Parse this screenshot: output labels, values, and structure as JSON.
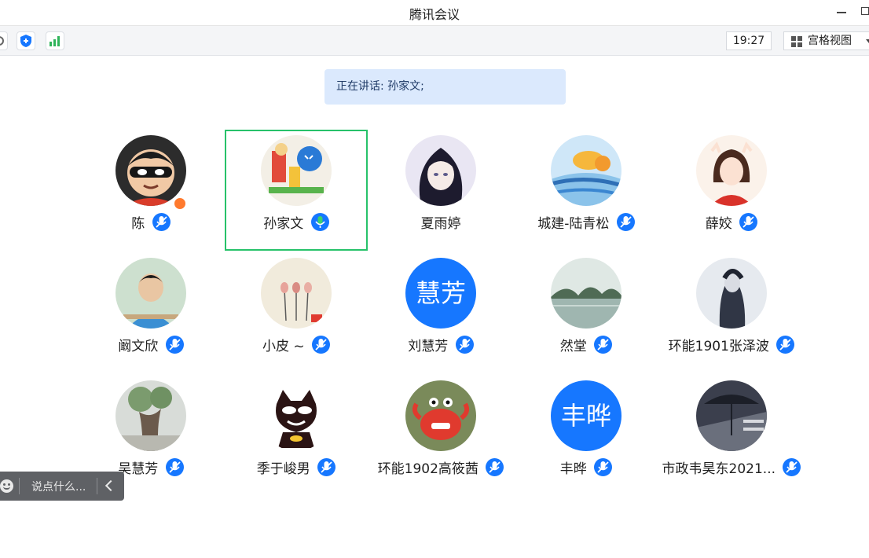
{
  "window": {
    "title": "腾讯会议"
  },
  "toolbar": {
    "time": "19:27",
    "view_label": "宫格视图",
    "icons": [
      "shield-icon",
      "signal-icon"
    ]
  },
  "speaking": {
    "text": "正在讲话: 孙家文;"
  },
  "colors": {
    "accent": "#1677ff",
    "speaking_bg": "#dbe9fd",
    "active_border": "#27c26a",
    "active_mic": "#27c26a"
  },
  "participants": [
    {
      "name": "陈",
      "mic": "muted"
    },
    {
      "name": "孙家文",
      "mic": "speaking"
    },
    {
      "name": "夏雨婷",
      "mic": "none"
    },
    {
      "name": "城建-陆青松",
      "mic": "muted"
    },
    {
      "name": "薛姣",
      "mic": "muted"
    },
    {
      "name": "阚文欣",
      "mic": "muted"
    },
    {
      "name": "小皮 ~",
      "mic": "muted"
    },
    {
      "name": "刘慧芳",
      "mic": "muted",
      "avatar_text": "慧芳"
    },
    {
      "name": "然堂",
      "mic": "muted"
    },
    {
      "name": "环能1901张泽波",
      "mic": "muted"
    },
    {
      "name": "吴慧芳",
      "mic": "muted"
    },
    {
      "name": "季于峻男",
      "mic": "muted"
    },
    {
      "name": "环能1902高筱茜",
      "mic": "muted"
    },
    {
      "name": "丰晔",
      "mic": "muted",
      "avatar_text": "丰晔"
    },
    {
      "name": "市政韦昊东2021...",
      "mic": "muted"
    }
  ],
  "chat": {
    "placeholder": "说点什么..."
  }
}
